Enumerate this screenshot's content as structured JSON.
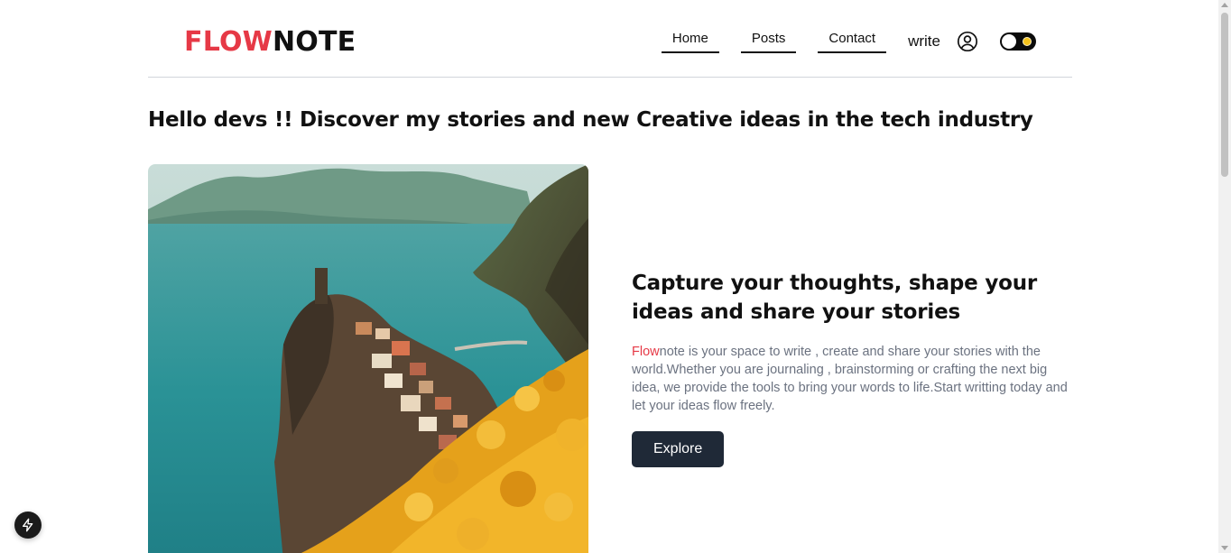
{
  "brand": {
    "part1": "FLOW",
    "part2": "NOTE",
    "accent_color": "#e63946"
  },
  "nav": {
    "items": [
      {
        "label": "Home"
      },
      {
        "label": "Posts"
      },
      {
        "label": "Contact"
      }
    ],
    "write_label": "write",
    "icons": {
      "user": "user-circle-icon",
      "theme": "theme-toggle-icon"
    }
  },
  "hero": {
    "headline": "Hello devs !! Discover my stories and new Creative ideas in the tech industry",
    "title": "Capture your thoughts, shape your ideas and share your stories",
    "description_accent": "Flow",
    "description_rest": "note is your space to write , create and share your stories with the world.Whether you are journaling , brainstorming or crafting the next big idea, we provide the tools to bring your words to life.Start writting today and let your ideas flow freely.",
    "button_label": "Explore",
    "button_color": "#1f2937"
  },
  "fab": {
    "icon": "lightning-bolt-icon"
  }
}
